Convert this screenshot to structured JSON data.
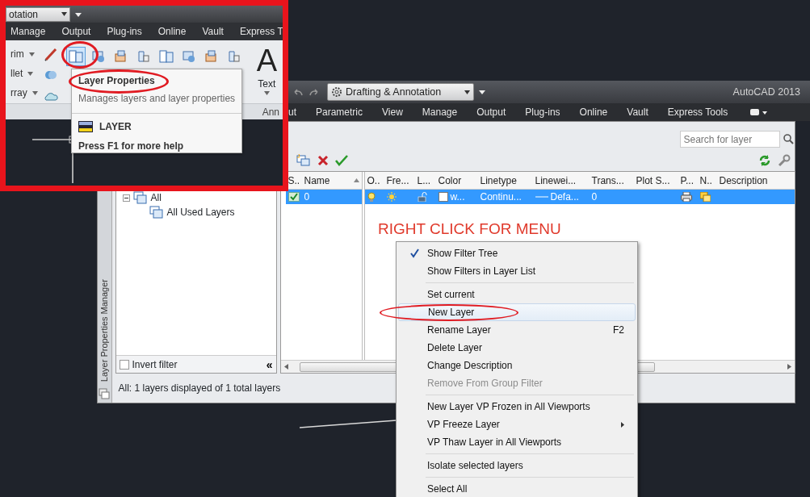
{
  "inset": {
    "workspace": "otation",
    "tabs": [
      "Manage",
      "Output",
      "Plug-ins",
      "Online",
      "Vault",
      "Express T"
    ],
    "tools": [
      {
        "label": "rim"
      },
      {
        "label": "llet"
      },
      {
        "label": "rray"
      }
    ],
    "layer_tools": [
      {
        "selected": true
      },
      {
        "selected": false
      },
      {
        "selected": false
      },
      {
        "selected": false
      },
      {
        "selected": false
      },
      {
        "selected": false
      },
      {
        "selected": false
      },
      {
        "selected": false
      }
    ],
    "text_glyph": "A",
    "text_tool": "Text",
    "panel_label": "Ann",
    "tooltip": {
      "title": "Layer Properties",
      "description": "Manages layers and layer properties",
      "command": "LAYER",
      "help": "Press F1 for more help"
    }
  },
  "window": {
    "workspace": "Drafting & Annotation",
    "title": "AutoCAD 2013"
  },
  "ribbon_tabs": [
    "ut",
    "Parametric",
    "View",
    "Manage",
    "Output",
    "Plug-ins",
    "Online",
    "Vault",
    "Express Tools"
  ],
  "layer_manager": {
    "side_title": "Layer Properties Manager",
    "search": {
      "placeholder": "Search for layer"
    },
    "filter_tree": [
      {
        "label": "All",
        "expanded": true,
        "children": [
          {
            "label": "All Used Layers"
          }
        ]
      }
    ],
    "invert_filter": {
      "label": "Invert filter",
      "checked": false
    },
    "collapse_button": "«",
    "columns": [
      "S..",
      "Name",
      "O..",
      "Fre...",
      "L...",
      "Color",
      "Linetype",
      "Linewei...",
      "Trans...",
      "Plot S...",
      "P...",
      "N..",
      "Description"
    ],
    "rows": [
      {
        "selected": true,
        "current": true,
        "name": "0",
        "on": true,
        "frozen": false,
        "locked": false,
        "color": "#ffffff",
        "color_name": "w...",
        "linetype": "Continu...",
        "lineweight": "Defa...",
        "transparency": "0"
      }
    ],
    "status": "All: 1 layers displayed of 1 total layers"
  },
  "annotation": "RIGHT CLICK FOR MENU",
  "context_menu": [
    {
      "kind": "item",
      "label": "Show Filter Tree",
      "checked": true,
      "selected": false,
      "disabled": false,
      "submenu": false
    },
    {
      "kind": "item",
      "label": "Show Filters in Layer List",
      "checked": false,
      "selected": false,
      "disabled": false,
      "submenu": false
    },
    {
      "kind": "separator"
    },
    {
      "kind": "item",
      "label": "Set current",
      "checked": false,
      "selected": false,
      "disabled": false,
      "submenu": false
    },
    {
      "kind": "item",
      "label": "New Layer",
      "checked": false,
      "selected": true,
      "disabled": false,
      "submenu": false
    },
    {
      "kind": "item",
      "label": "Rename Layer",
      "shortcut": "F2",
      "checked": false,
      "selected": false,
      "disabled": false,
      "submenu": false
    },
    {
      "kind": "item",
      "label": "Delete Layer",
      "checked": false,
      "selected": false,
      "disabled": false,
      "submenu": false
    },
    {
      "kind": "item",
      "label": "Change Description",
      "checked": false,
      "selected": false,
      "disabled": false,
      "submenu": false
    },
    {
      "kind": "item",
      "label": "Remove From Group Filter",
      "checked": false,
      "selected": false,
      "disabled": true,
      "submenu": false
    },
    {
      "kind": "separator"
    },
    {
      "kind": "item",
      "label": "New Layer VP Frozen in All Viewports",
      "checked": false,
      "selected": false,
      "disabled": false,
      "submenu": false
    },
    {
      "kind": "item",
      "label": "VP Freeze Layer",
      "checked": false,
      "selected": false,
      "disabled": false,
      "submenu": true
    },
    {
      "kind": "item",
      "label": "VP Thaw Layer in All Viewports",
      "checked": false,
      "selected": false,
      "disabled": false,
      "submenu": false
    },
    {
      "kind": "separator"
    },
    {
      "kind": "item",
      "label": "Isolate selected layers",
      "checked": false,
      "selected": false,
      "disabled": false,
      "submenu": false
    },
    {
      "kind": "separator"
    },
    {
      "kind": "item",
      "label": "Select All",
      "checked": false,
      "selected": false,
      "disabled": false,
      "submenu": false
    }
  ]
}
